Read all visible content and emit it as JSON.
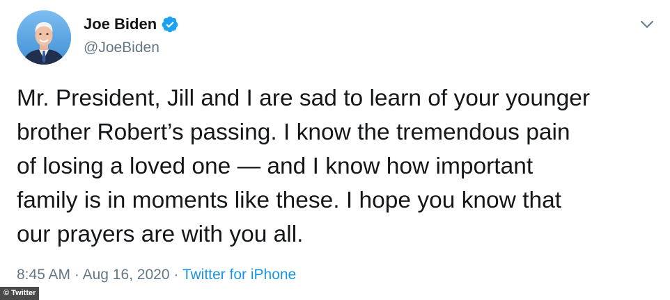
{
  "author": {
    "display_name": "Joe Biden",
    "handle": "@JoeBiden",
    "verified": true,
    "avatar_icon": "profile-photo"
  },
  "tweet": {
    "lines": [
      "Mr. President, Jill and I are sad to learn of your younger",
      "brother Robert’s passing. I know the tremendous pain",
      "of losing a loved one — and I know how important",
      "family is in moments like these. I hope you know that",
      "our prayers are with you all."
    ]
  },
  "meta": {
    "time": "8:45 AM",
    "separator": " · ",
    "date": "Aug 16, 2020",
    "source": "Twitter for iPhone"
  },
  "menu_icon": "chevron-down-icon",
  "credit": "© Twitter",
  "colors": {
    "text": "#14171a",
    "secondary": "#657786",
    "link": "#1b95e0",
    "verified": "#1da1f2"
  }
}
